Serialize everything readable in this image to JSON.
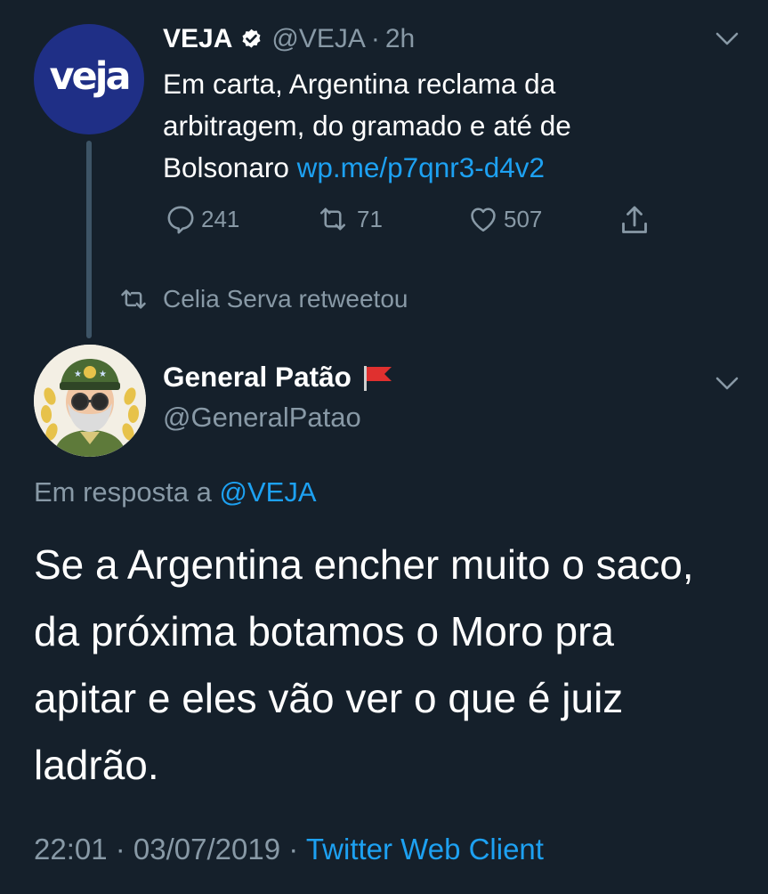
{
  "parent_tweet": {
    "avatar_text": "veja",
    "display_name": "VEJA",
    "handle": "@VEJA",
    "separator": "·",
    "time": "2h",
    "text_line1": "Em carta, Argentina reclama da",
    "text_line2": "arbitragem, do gramado e até de",
    "text_line3": "Bolsonaro",
    "link": "wp.me/p7qnr3-d4v2",
    "actions": {
      "replies": "241",
      "retweets": "71",
      "likes": "507"
    }
  },
  "retweet_context": {
    "text": "Celia Serva retweetou"
  },
  "main_tweet": {
    "display_name": "General Patão",
    "handle": "@GeneralPatao",
    "reply_prefix": "Em resposta a",
    "reply_handle": "@VEJA",
    "text_line1": "Se a Argentina encher muito o saco,",
    "text_line2": "da próxima botamos o Moro pra",
    "text_line3": "apitar e eles vão ver o que é juiz",
    "text_line4": "ladrão.",
    "timestamp": "22:01 · 03/07/2019 ·",
    "source": "Twitter Web Client"
  },
  "icons": {
    "verified": "verified-badge-icon",
    "caret": "chevron-down-icon",
    "reply": "reply-icon",
    "retweet": "retweet-icon",
    "like": "heart-icon",
    "share": "share-icon",
    "flag": "red-flag-icon"
  },
  "colors": {
    "background": "#15202b",
    "text": "#ffffff",
    "muted": "#8899a6",
    "link": "#1da1f2",
    "veja_avatar": "#1f2f86",
    "thread_line": "#3d5466"
  }
}
